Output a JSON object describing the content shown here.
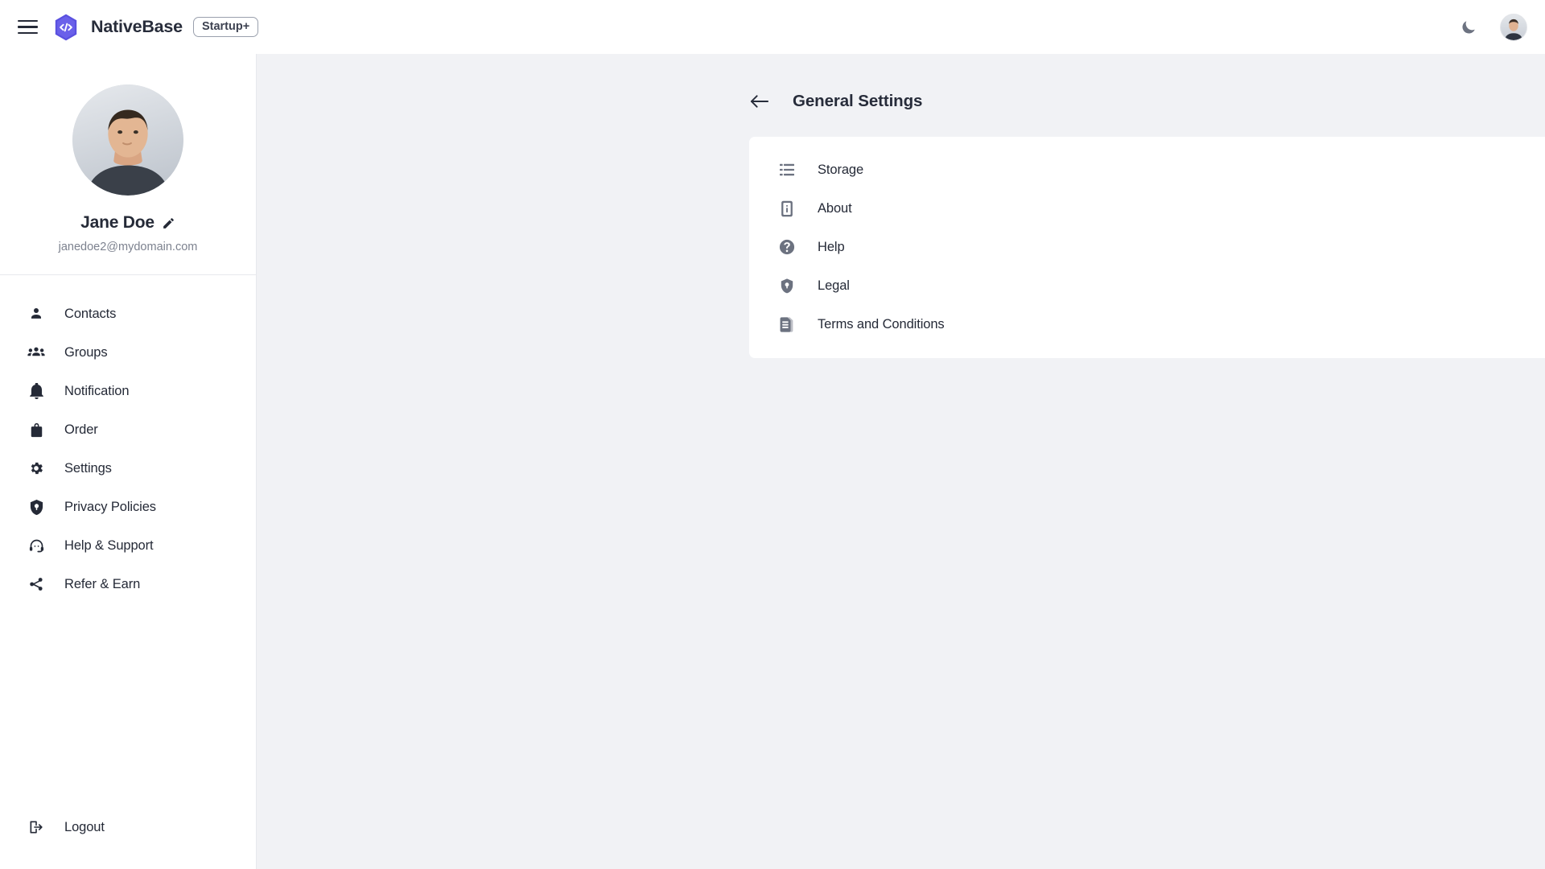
{
  "header": {
    "menu_icon": "hamburger-menu-icon",
    "logo_icon": "nativebase-code-hexagon-logo",
    "brand_name": "NativeBase",
    "badge_label": "Startup+",
    "theme_toggle_icon": "moon-icon",
    "avatar_icon": "user-avatar",
    "brand_color": "#5a51e0",
    "background": "#ffffff"
  },
  "sidebar": {
    "profile": {
      "avatar_icon": "user-avatar-large",
      "name": "Jane Doe",
      "edit_icon": "pencil-edit-icon",
      "email": "janedoe2@mydomain.com"
    },
    "items": [
      {
        "label": "Contacts",
        "icon": "person-icon"
      },
      {
        "label": "Groups",
        "icon": "people-group-icon"
      },
      {
        "label": "Notification",
        "icon": "bell-icon"
      },
      {
        "label": "Order",
        "icon": "shopping-bag-icon"
      },
      {
        "label": "Settings",
        "icon": "gear-icon"
      },
      {
        "label": "Privacy Policies",
        "icon": "shield-lock-icon"
      },
      {
        "label": "Help & Support",
        "icon": "headset-support-icon"
      },
      {
        "label": "Refer & Earn",
        "icon": "share-nodes-icon"
      }
    ],
    "logout": {
      "label": "Logout",
      "icon": "logout-exit-icon"
    },
    "background": "#ffffff",
    "border_color": "#e7e9ed"
  },
  "main": {
    "background": "#f1f2f5",
    "back_icon": "arrow-left-icon",
    "title": "General Settings",
    "card": {
      "background": "#ffffff",
      "items": [
        {
          "label": "Storage",
          "icon": "storage-list-icon"
        },
        {
          "label": "About",
          "icon": "phone-info-icon"
        },
        {
          "label": "Help",
          "icon": "question-circle-icon"
        },
        {
          "label": "Legal",
          "icon": "shield-lock-icon"
        },
        {
          "label": "Terms and Conditions",
          "icon": "document-text-icon"
        }
      ]
    }
  }
}
